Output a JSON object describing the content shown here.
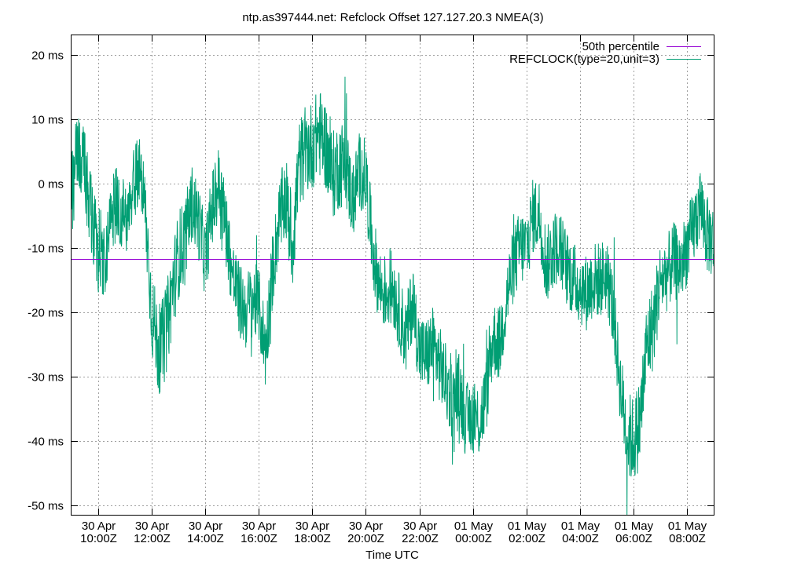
{
  "chart_data": {
    "type": "line",
    "title": "ntp.as397444.net: Refclock Offset 127.127.20.3 NMEA(3)",
    "xlabel": "Time UTC",
    "ylabel": "",
    "y_unit": "ms",
    "ylim": [
      -51.5,
      23
    ],
    "y_ticks": [
      20,
      10,
      0,
      -10,
      -20,
      -30,
      -40,
      -50
    ],
    "y_tick_labels": [
      "20 ms",
      "10 ms",
      "0 ms",
      "-10 ms",
      "-20 ms",
      "-30 ms",
      "-40 ms",
      "-50 ms"
    ],
    "xlim": [
      "2024-04-30T09:00Z",
      "2024-05-01T09:00Z"
    ],
    "x_ticks": [
      {
        "t": "2024-04-30T10:00Z",
        "line1": "30 Apr",
        "line2": "10:00Z"
      },
      {
        "t": "2024-04-30T12:00Z",
        "line1": "30 Apr",
        "line2": "12:00Z"
      },
      {
        "t": "2024-04-30T14:00Z",
        "line1": "30 Apr",
        "line2": "14:00Z"
      },
      {
        "t": "2024-04-30T16:00Z",
        "line1": "30 Apr",
        "line2": "16:00Z"
      },
      {
        "t": "2024-04-30T18:00Z",
        "line1": "30 Apr",
        "line2": "18:00Z"
      },
      {
        "t": "2024-04-30T20:00Z",
        "line1": "30 Apr",
        "line2": "20:00Z"
      },
      {
        "t": "2024-04-30T22:00Z",
        "line1": "30 Apr",
        "line2": "22:00Z"
      },
      {
        "t": "2024-05-01T00:00Z",
        "line1": "01 May",
        "line2": "00:00Z"
      },
      {
        "t": "2024-05-01T02:00Z",
        "line1": "01 May",
        "line2": "02:00Z"
      },
      {
        "t": "2024-05-01T04:00Z",
        "line1": "01 May",
        "line2": "04:00Z"
      },
      {
        "t": "2024-05-01T06:00Z",
        "line1": "01 May",
        "line2": "06:00Z"
      },
      {
        "t": "2024-05-01T08:00Z",
        "line1": "01 May",
        "line2": "08:00Z"
      }
    ],
    "grid": true,
    "legend_position": "top-right",
    "series": [
      {
        "name": "50th percentile",
        "color": "#9400d3",
        "kind": "constant",
        "value": -11.8
      },
      {
        "name": "REFCLOCK(type=20,unit=3)",
        "color": "#009e73",
        "kind": "noisy_trend",
        "x": [
          "2024-04-30T09:00Z",
          "2024-04-30T09:15Z",
          "2024-04-30T09:30Z",
          "2024-04-30T09:45Z",
          "2024-04-30T10:00Z",
          "2024-04-30T10:15Z",
          "2024-04-30T10:30Z",
          "2024-04-30T10:45Z",
          "2024-04-30T11:00Z",
          "2024-04-30T11:15Z",
          "2024-04-30T11:30Z",
          "2024-04-30T11:45Z",
          "2024-04-30T12:00Z",
          "2024-04-30T12:15Z",
          "2024-04-30T12:30Z",
          "2024-04-30T12:45Z",
          "2024-04-30T13:00Z",
          "2024-04-30T13:15Z",
          "2024-04-30T13:30Z",
          "2024-04-30T13:45Z",
          "2024-04-30T14:00Z",
          "2024-04-30T14:15Z",
          "2024-04-30T14:30Z",
          "2024-04-30T14:45Z",
          "2024-04-30T15:00Z",
          "2024-04-30T15:15Z",
          "2024-04-30T15:30Z",
          "2024-04-30T15:45Z",
          "2024-04-30T16:00Z",
          "2024-04-30T16:15Z",
          "2024-04-30T16:30Z",
          "2024-04-30T16:45Z",
          "2024-04-30T17:00Z",
          "2024-04-30T17:15Z",
          "2024-04-30T17:30Z",
          "2024-04-30T17:45Z",
          "2024-04-30T18:00Z",
          "2024-04-30T18:15Z",
          "2024-04-30T18:30Z",
          "2024-04-30T18:45Z",
          "2024-04-30T19:00Z",
          "2024-04-30T19:15Z",
          "2024-04-30T19:30Z",
          "2024-04-30T19:45Z",
          "2024-04-30T20:00Z",
          "2024-04-30T20:15Z",
          "2024-04-30T20:30Z",
          "2024-04-30T20:45Z",
          "2024-04-30T21:00Z",
          "2024-04-30T21:15Z",
          "2024-04-30T21:30Z",
          "2024-04-30T21:45Z",
          "2024-04-30T22:00Z",
          "2024-04-30T22:15Z",
          "2024-04-30T22:30Z",
          "2024-04-30T22:45Z",
          "2024-04-30T23:00Z",
          "2024-04-30T23:15Z",
          "2024-04-30T23:30Z",
          "2024-04-30T23:45Z",
          "2024-05-01T00:00Z",
          "2024-05-01T00:15Z",
          "2024-05-01T00:30Z",
          "2024-05-01T00:45Z",
          "2024-05-01T01:00Z",
          "2024-05-01T01:15Z",
          "2024-05-01T01:30Z",
          "2024-05-01T01:45Z",
          "2024-05-01T02:00Z",
          "2024-05-01T02:15Z",
          "2024-05-01T02:30Z",
          "2024-05-01T02:45Z",
          "2024-05-01T03:00Z",
          "2024-05-01T03:15Z",
          "2024-05-01T03:30Z",
          "2024-05-01T03:45Z",
          "2024-05-01T04:00Z",
          "2024-05-01T04:15Z",
          "2024-05-01T04:30Z",
          "2024-05-01T04:45Z",
          "2024-05-01T05:00Z",
          "2024-05-01T05:15Z",
          "2024-05-01T05:30Z",
          "2024-05-01T05:45Z",
          "2024-05-01T06:00Z",
          "2024-05-01T06:15Z",
          "2024-05-01T06:30Z",
          "2024-05-01T06:45Z",
          "2024-05-01T07:00Z",
          "2024-05-01T07:15Z",
          "2024-05-01T07:30Z",
          "2024-05-01T07:45Z",
          "2024-05-01T08:00Z",
          "2024-05-01T08:15Z",
          "2024-05-01T08:30Z",
          "2024-05-01T08:45Z",
          "2024-05-01T09:00Z"
        ],
        "y": [
          -2,
          5,
          1,
          -6,
          -10,
          -12,
          -4,
          -3,
          -6,
          -2,
          3,
          -4,
          -20,
          -26,
          -24,
          -17,
          -11,
          -9,
          -3,
          -6,
          -12,
          -4,
          0,
          -6,
          -14,
          -18,
          -20,
          -18,
          -19,
          -26,
          -14,
          -6,
          -2,
          -10,
          3,
          5,
          6,
          8,
          6,
          1,
          3,
          3,
          -3,
          2,
          1,
          -10,
          -16,
          -17,
          -16,
          -20,
          -24,
          -18,
          -26,
          -27,
          -25,
          -28,
          -31,
          -34,
          -32,
          -37,
          -36,
          -37,
          -33,
          -24,
          -25,
          -18,
          -13,
          -10,
          -10,
          -5,
          -5,
          -13,
          -10,
          -10,
          -13,
          -15,
          -16,
          -17,
          -15,
          -15,
          -14,
          -20,
          -31,
          -39,
          -40,
          -37,
          -25,
          -22,
          -15,
          -14,
          -12,
          -13,
          -10,
          -7,
          -3,
          -8,
          -9
        ],
        "band": [
          7,
          7,
          7,
          7,
          7,
          6,
          6,
          6,
          6,
          6,
          6,
          6,
          7,
          7,
          7,
          7,
          7,
          7,
          6,
          6,
          6,
          6,
          6,
          6,
          6,
          6,
          6,
          6,
          6,
          6,
          6,
          6,
          7,
          7,
          7,
          7,
          7,
          7,
          7,
          7,
          7,
          7,
          6,
          6,
          6,
          6,
          6,
          6,
          6,
          6,
          6,
          6,
          6,
          6,
          6,
          6,
          6,
          6,
          6,
          6,
          6,
          6,
          6,
          6,
          6,
          6,
          6,
          6,
          6,
          6,
          6,
          6,
          6,
          6,
          6,
          6,
          6,
          6,
          6,
          6,
          6,
          6,
          6,
          7,
          7,
          7,
          7,
          7,
          6,
          6,
          6,
          6,
          6,
          6,
          6,
          6,
          6
        ]
      }
    ]
  }
}
